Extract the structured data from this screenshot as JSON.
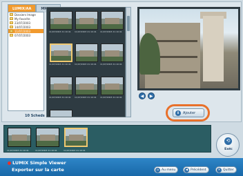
{
  "tabs": [
    {
      "label": "LUMIX/AA",
      "active": true
    },
    {
      "label": "MMXXA",
      "active": false
    }
  ],
  "tree": {
    "items": [
      {
        "label": "Dossiers Image",
        "selected": false
      },
      {
        "label": "My favorite",
        "selected": false
      },
      {
        "label": "23/07/2003",
        "selected": false
      },
      {
        "label": "14/07/2003",
        "selected": false
      },
      {
        "label": "11/07/2003",
        "selected": true
      },
      {
        "label": "07/07/2003",
        "selected": false
      }
    ]
  },
  "count_label": "10 Scheds",
  "thumbnails": [
    {
      "label": "11/07/2003 21:10:41",
      "selected": false
    },
    {
      "label": "11/07/2003 21:10:41",
      "selected": false
    },
    {
      "label": "11/07/2003 21:10:41",
      "selected": false
    },
    {
      "label": "11/07/2003 21:10:41",
      "selected": true
    },
    {
      "label": "11/07/2003 21:10:41",
      "selected": false
    },
    {
      "label": "11/07/2003 21:10:41",
      "selected": false
    },
    {
      "label": "11/07/2003 21:10:41",
      "selected": false
    },
    {
      "label": "11/07/2003 21:10:41",
      "selected": false
    },
    {
      "label": "11/07/2003 21:10:41",
      "selected": false
    },
    {
      "label": "",
      "selected": false
    }
  ],
  "nav": {
    "prev_icon": "◀",
    "next_icon": "▶"
  },
  "ajouter": {
    "label": "Ajouter",
    "icon": "⬇"
  },
  "tray": [
    {
      "label": "11/07/2003 21:10:41",
      "selected": false
    },
    {
      "label": "11/07/2003 21:10:41",
      "selected": false
    },
    {
      "label": "11/07/2003 21:10:41",
      "selected": true
    }
  ],
  "execute": {
    "label": "Exéc",
    "icon": "⟲"
  },
  "footer": {
    "brand": "LUMIX Simple Viewer",
    "subtitle": "Exporter sur la carte",
    "buttons": [
      {
        "label": "Au menu",
        "icon": "⌂"
      },
      {
        "label": "Précédent",
        "icon": "◀"
      },
      {
        "label": "Quitter",
        "icon": "✕"
      }
    ]
  },
  "colors": {
    "accent": "#f19a2e",
    "ring": "#e8702a",
    "footer": "#1f73b3"
  }
}
